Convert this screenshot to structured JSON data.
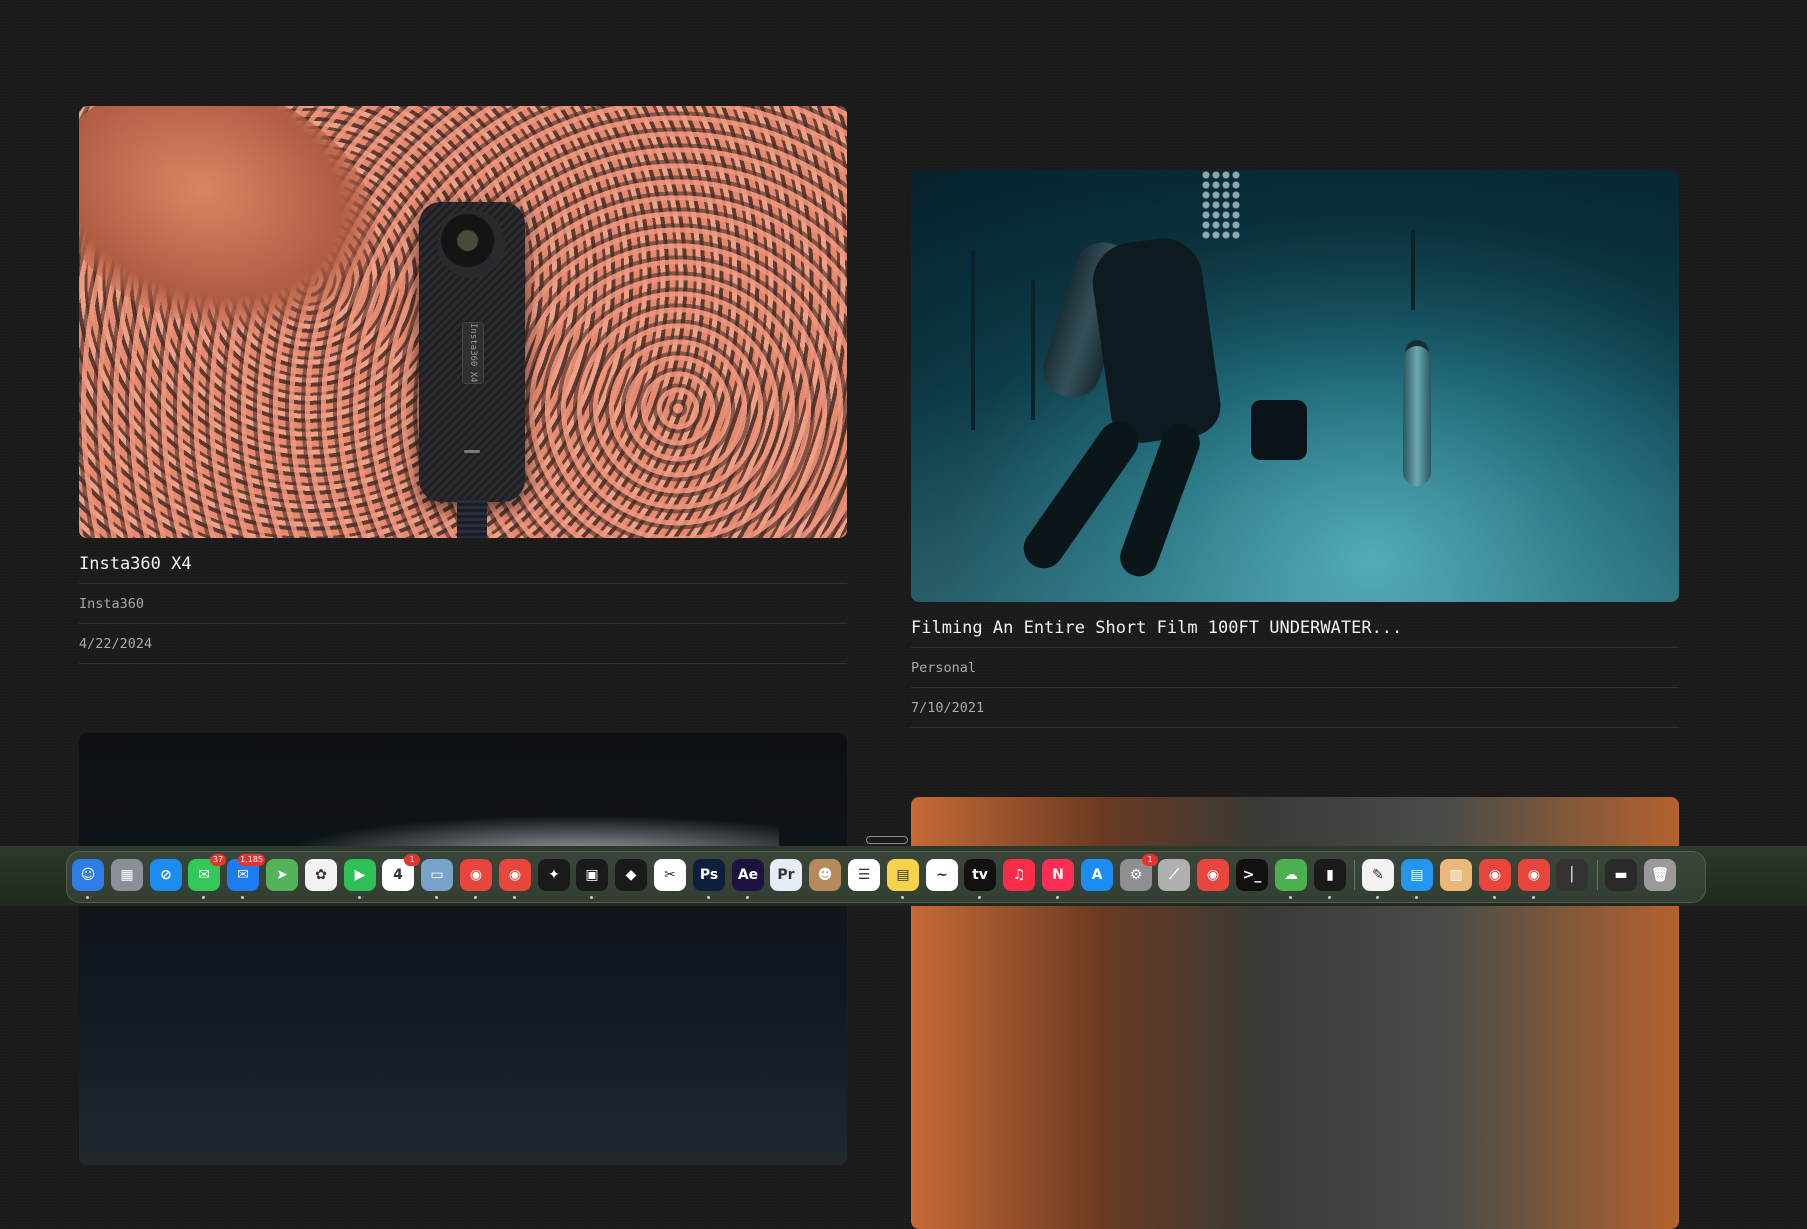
{
  "cards": [
    {
      "title": "Insta360 X4",
      "client": "Insta360",
      "date": "4/22/2024",
      "thumb_alt": "Insta360 X4 camera on salmon-colored ropes",
      "camera_text": "Insta360 X4"
    },
    {
      "title": "Filming An Entire Short Film 100FT UNDERWATER...",
      "client": "Personal",
      "date": "7/10/2021",
      "thumb_alt": "Diver filming a model underwater"
    }
  ],
  "dock": {
    "apps": [
      {
        "name": "Finder",
        "icon": "finder-icon",
        "color": "#2f7ee8",
        "glyph": "☺"
      },
      {
        "name": "Launchpad",
        "icon": "launchpad-icon",
        "color": "#8a8f99",
        "glyph": "▦"
      },
      {
        "name": "Safari",
        "icon": "safari-icon",
        "color": "#1d8cf0",
        "glyph": "⊘"
      },
      {
        "name": "Messages",
        "icon": "messages-icon",
        "color": "#34c759",
        "glyph": "✉",
        "badge": "37"
      },
      {
        "name": "Mail",
        "icon": "mail-icon",
        "color": "#1e7cf2",
        "glyph": "✉",
        "badge": "1,185"
      },
      {
        "name": "Maps",
        "icon": "maps-icon",
        "color": "#53b35a",
        "glyph": "➤"
      },
      {
        "name": "Photos",
        "icon": "photos-icon",
        "color": "#f2f2f2",
        "glyph": "✿"
      },
      {
        "name": "FaceTime",
        "icon": "facetime-icon",
        "color": "#2fc157",
        "glyph": "▶"
      },
      {
        "name": "Calendar",
        "icon": "calendar-icon",
        "color": "#ffffff",
        "glyph": "4",
        "badge": "1"
      },
      {
        "name": "Preview",
        "icon": "preview-icon",
        "color": "#7aa3c9",
        "glyph": "▭"
      },
      {
        "name": "Chrome",
        "icon": "chrome-icon",
        "color": "#e8453c",
        "glyph": "◉"
      },
      {
        "name": "Chrome",
        "icon": "chrome-icon",
        "color": "#e8453c",
        "glyph": "◉"
      },
      {
        "name": "ChatGPT",
        "icon": "chatgpt-icon",
        "color": "#1a1a1a",
        "glyph": "✦"
      },
      {
        "name": "Terminal App",
        "icon": "robot-icon",
        "color": "#1a1a1a",
        "glyph": "▣"
      },
      {
        "name": "Cube",
        "icon": "cube-icon",
        "color": "#1a1a1a",
        "glyph": "◆"
      },
      {
        "name": "CapCut",
        "icon": "capcut-icon",
        "color": "#ffffff",
        "glyph": "✂"
      },
      {
        "name": "Photoshop",
        "icon": "photoshop-icon",
        "color": "#0d1f3c",
        "glyph": "Ps"
      },
      {
        "name": "After Effects",
        "icon": "after-effects-icon",
        "color": "#1d1240",
        "glyph": "Ae"
      },
      {
        "name": "Premiere Pro",
        "icon": "premiere-icon",
        "color": "#e6ecf5",
        "glyph": "Pr"
      },
      {
        "name": "Contacts",
        "icon": "contacts-icon",
        "color": "#b58a5c",
        "glyph": "☻"
      },
      {
        "name": "Reminders",
        "icon": "reminders-icon",
        "color": "#ffffff",
        "glyph": "☰"
      },
      {
        "name": "Notes",
        "icon": "notes-icon",
        "color": "#f6d34a",
        "glyph": "▤"
      },
      {
        "name": "Freeform",
        "icon": "freeform-icon",
        "color": "#ffffff",
        "glyph": "~"
      },
      {
        "name": "Apple TV",
        "icon": "apple-tv-icon",
        "color": "#111111",
        "glyph": "tv"
      },
      {
        "name": "Music",
        "icon": "music-icon",
        "color": "#fa2d48",
        "glyph": "♫"
      },
      {
        "name": "News",
        "icon": "news-icon",
        "color": "#ff2d55",
        "glyph": "N"
      },
      {
        "name": "App Store",
        "icon": "app-store-icon",
        "color": "#1c8cf2",
        "glyph": "A"
      },
      {
        "name": "System Settings",
        "icon": "settings-icon",
        "color": "#8e8e93",
        "glyph": "⚙",
        "badge": "1"
      },
      {
        "name": "Tool",
        "icon": "tool-icon",
        "color": "#b0b0b0",
        "glyph": "⟋"
      },
      {
        "name": "Chrome",
        "icon": "chrome-icon",
        "color": "#e8453c",
        "glyph": "◉"
      },
      {
        "name": "Terminal",
        "icon": "terminal-icon",
        "color": "#111111",
        "glyph": ">_"
      },
      {
        "name": "Cloud Upload",
        "icon": "cloud-upload-icon",
        "color": "#4caf50",
        "glyph": "☁"
      },
      {
        "name": "Audio",
        "icon": "audio-meter-icon",
        "color": "#1a1a1a",
        "glyph": "▮"
      },
      {
        "name": "TextEdit",
        "icon": "textedit-icon",
        "color": "#f2f2f2",
        "glyph": "✎"
      },
      {
        "name": "Docker",
        "icon": "docker-icon",
        "color": "#2496ed",
        "glyph": "▤"
      },
      {
        "name": "Archive",
        "icon": "archive-icon",
        "color": "#e8b97a",
        "glyph": "▥"
      },
      {
        "name": "Chrome",
        "icon": "chrome-icon",
        "color": "#e8453c",
        "glyph": "◉"
      },
      {
        "name": "Chrome",
        "icon": "chrome-icon",
        "color": "#e8453c",
        "glyph": "◉"
      },
      {
        "name": "Pen",
        "icon": "pen-icon",
        "color": "#333333",
        "glyph": "│"
      },
      {
        "name": "Screen",
        "icon": "screen-icon",
        "color": "#2a2a2a",
        "glyph": "▬"
      },
      {
        "name": "Trash",
        "icon": "trash-icon",
        "color": "#9a9a9a",
        "glyph": "🗑"
      }
    ]
  }
}
